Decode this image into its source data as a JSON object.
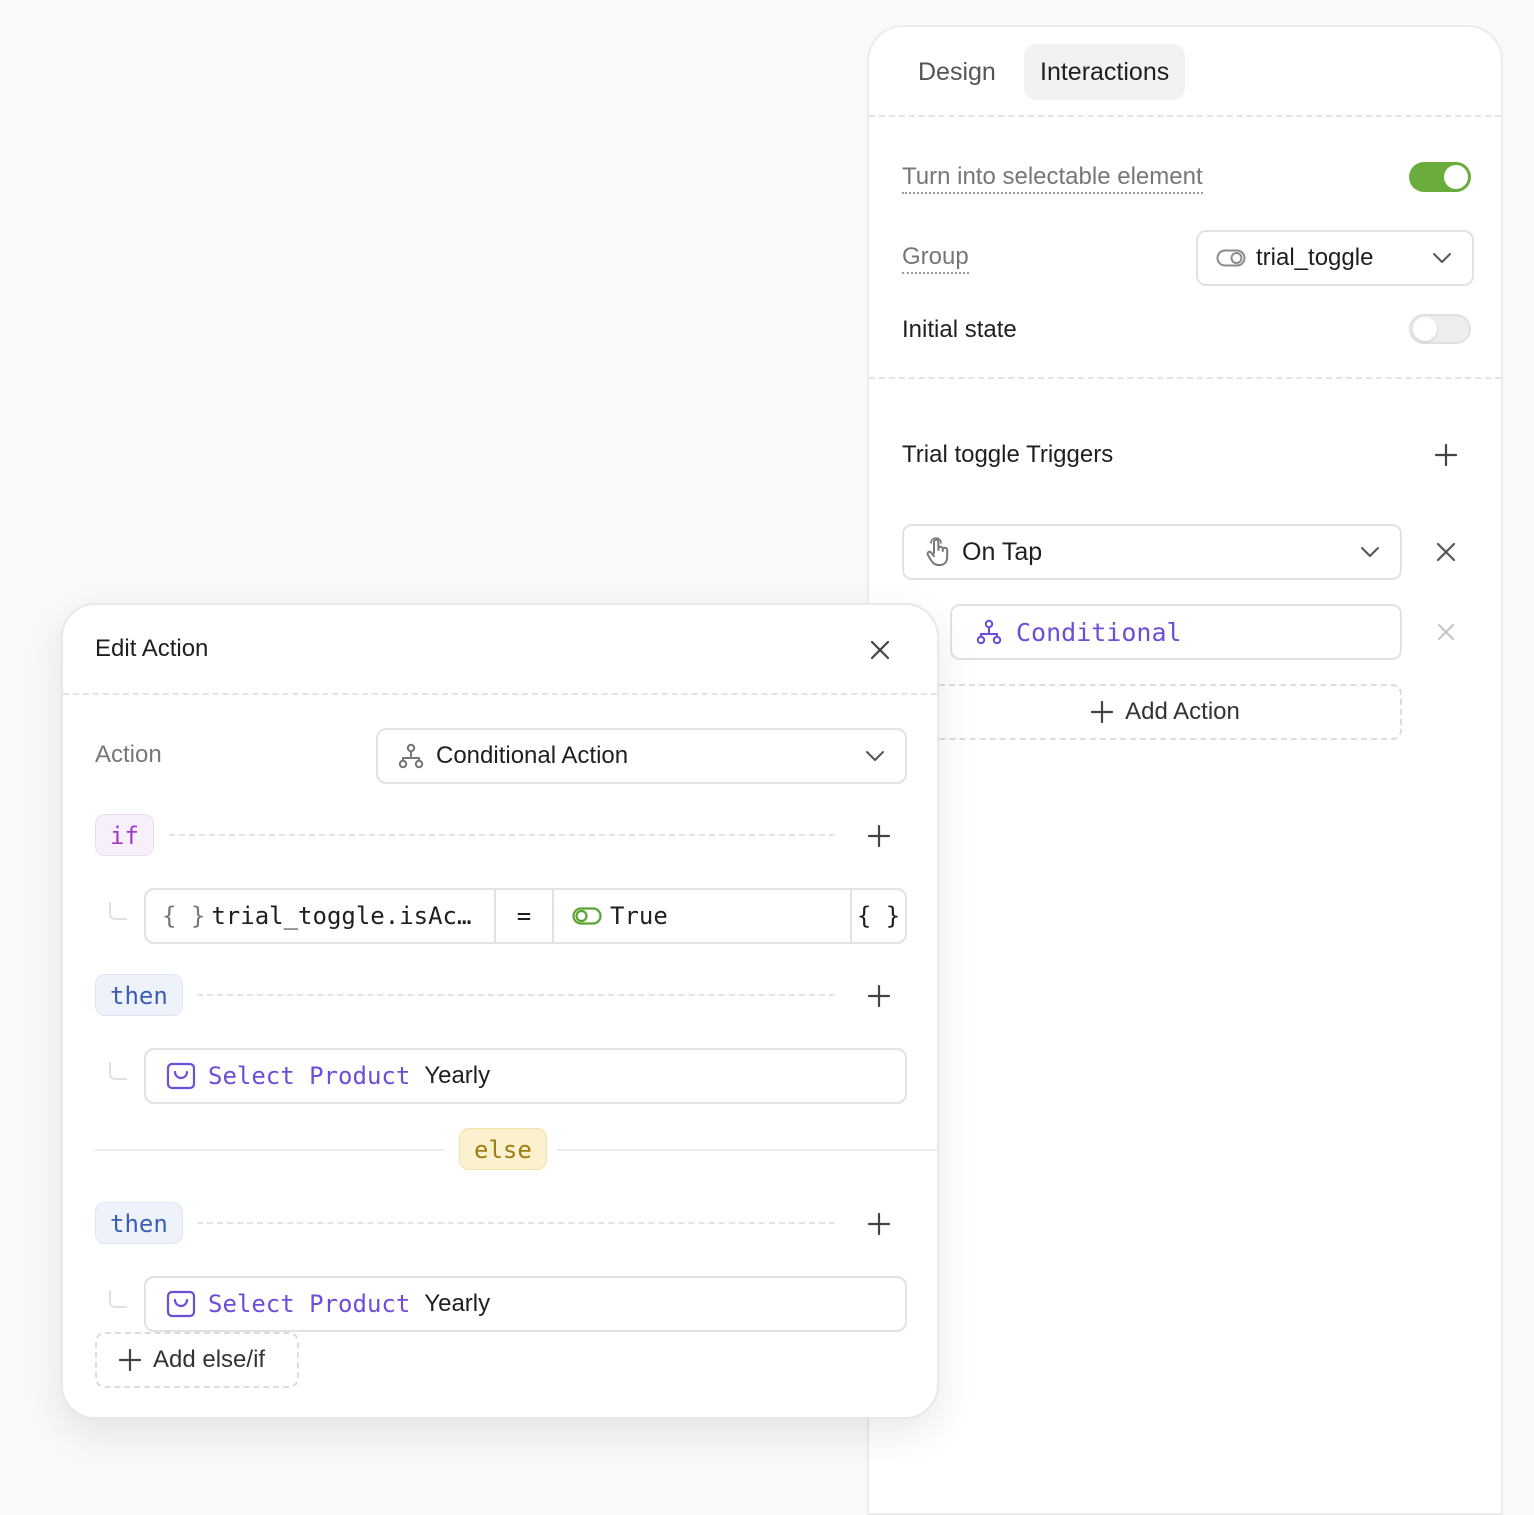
{
  "tabs": [
    {
      "label": "Design",
      "active": false
    },
    {
      "label": "Interactions",
      "active": true
    }
  ],
  "settings": {
    "selectable_label": "Turn into selectable element",
    "selectable_on": true,
    "group_label": "Group",
    "group_value": "trial_toggle",
    "initial_state_label": "Initial state",
    "initial_state_on": false
  },
  "triggers": {
    "title": "Trial toggle Triggers",
    "trigger_value": "On Tap",
    "action_item": "Conditional",
    "add_action_label": "Add Action"
  },
  "modal": {
    "title": "Edit Action",
    "action_label": "Action",
    "action_value": "Conditional Action",
    "if_label": "if",
    "condition": {
      "variable_braces": "{ }",
      "variable": "trial_toggle.isAc…",
      "operator": "=",
      "value": "True",
      "value_braces": "{ }"
    },
    "then_label": "then",
    "then_action": {
      "action": "Select Product",
      "value": "Yearly"
    },
    "else_label": "else",
    "else_then_label": "then",
    "else_action": {
      "action": "Select Product",
      "value": "Yearly"
    },
    "add_elseif_label": "Add else/if"
  },
  "colors": {
    "toggle_on": "#6aad3e",
    "action_purple": "#6b4fd8",
    "if_purple": "#a13bc7",
    "then_blue": "#3b5db8",
    "else_gold": "#9f7d12"
  }
}
